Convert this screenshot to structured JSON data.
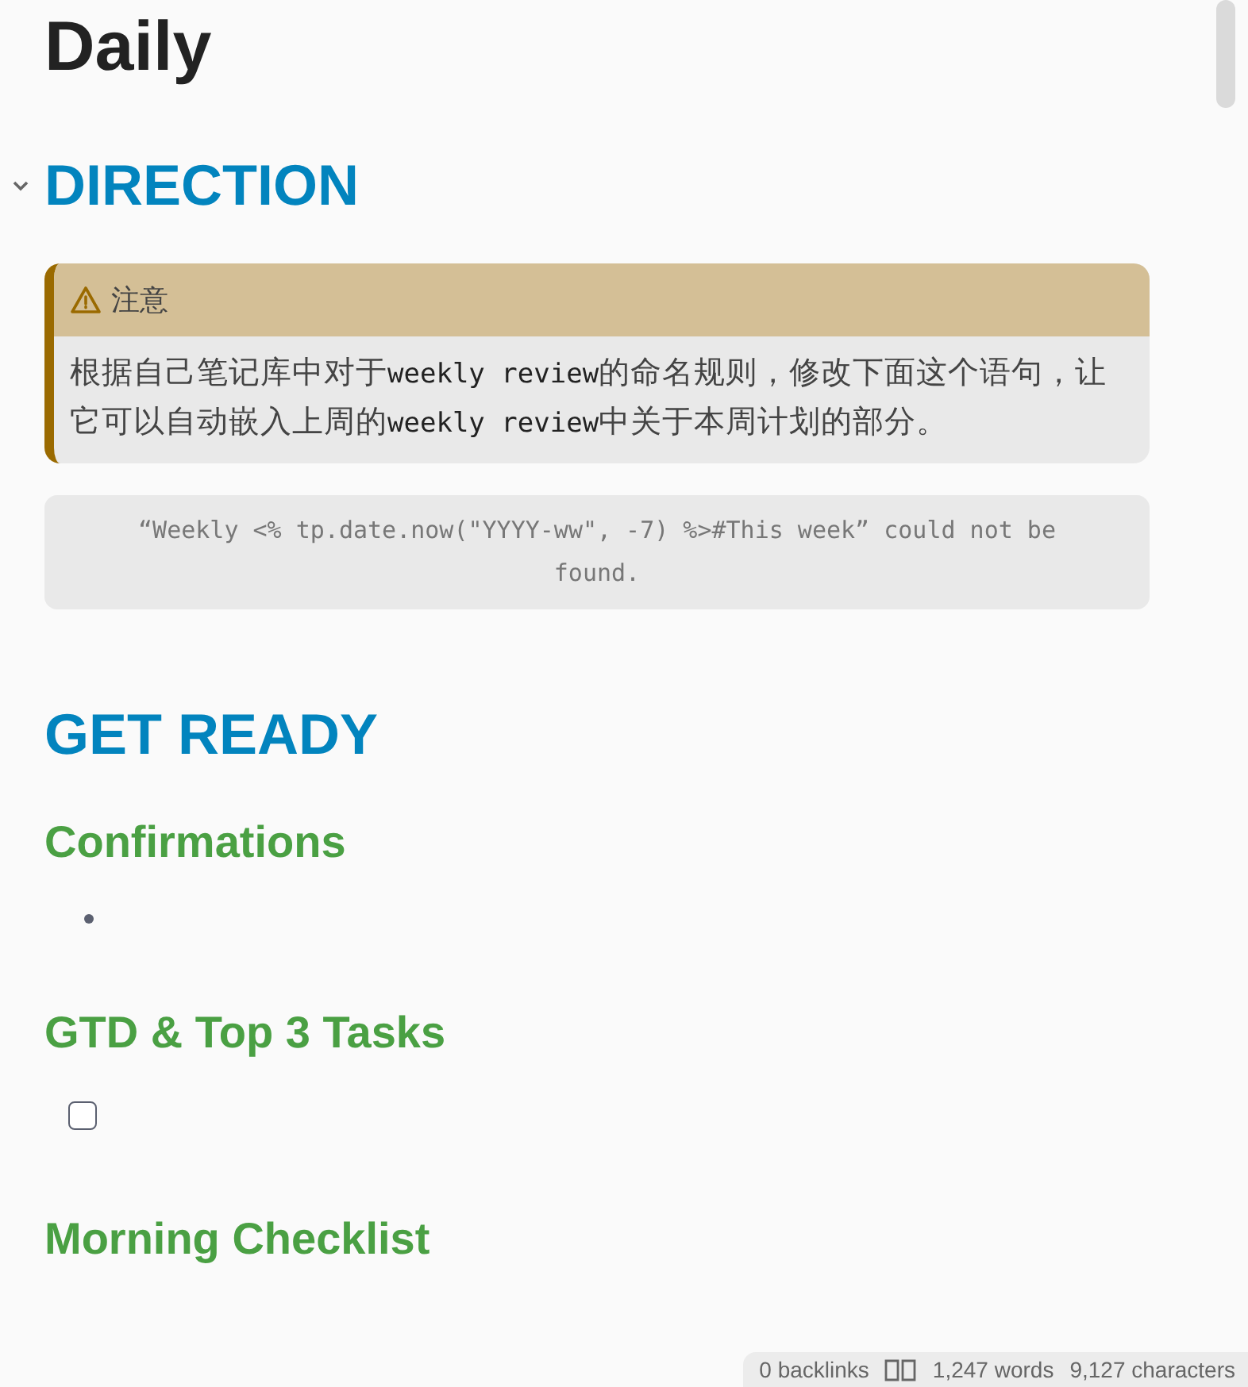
{
  "title": "Daily",
  "blocks": [
    {
      "kind": "h1",
      "text": "DIRECTION",
      "expanded": true
    },
    {
      "kind": "callout",
      "title": "注意",
      "segments": [
        {
          "text": "根据自己笔记库中对于",
          "code": false
        },
        {
          "text": "weekly review",
          "code": true
        },
        {
          "text": "的命名规则，修改下面这个语句，让它可以自动嵌入上周的",
          "code": false
        },
        {
          "text": "weekly review",
          "code": true
        },
        {
          "text": "中关于本周计划的部分。",
          "code": false
        }
      ]
    },
    {
      "kind": "embed",
      "text": "“Weekly <% tp.date.now(\"YYYY-ww\", -7) %>#This week” could not be found."
    },
    {
      "kind": "h1",
      "text": "GET READY"
    },
    {
      "kind": "h2",
      "text": "Confirmations"
    },
    {
      "kind": "bullet"
    },
    {
      "kind": "h2",
      "text": "GTD & Top 3 Tasks"
    },
    {
      "kind": "task",
      "checked": false
    },
    {
      "kind": "h2",
      "text": "Morning Checklist"
    }
  ],
  "status_bar": {
    "backlinks": "0 backlinks",
    "words": "1,247 words",
    "characters": "9,127 characters"
  }
}
